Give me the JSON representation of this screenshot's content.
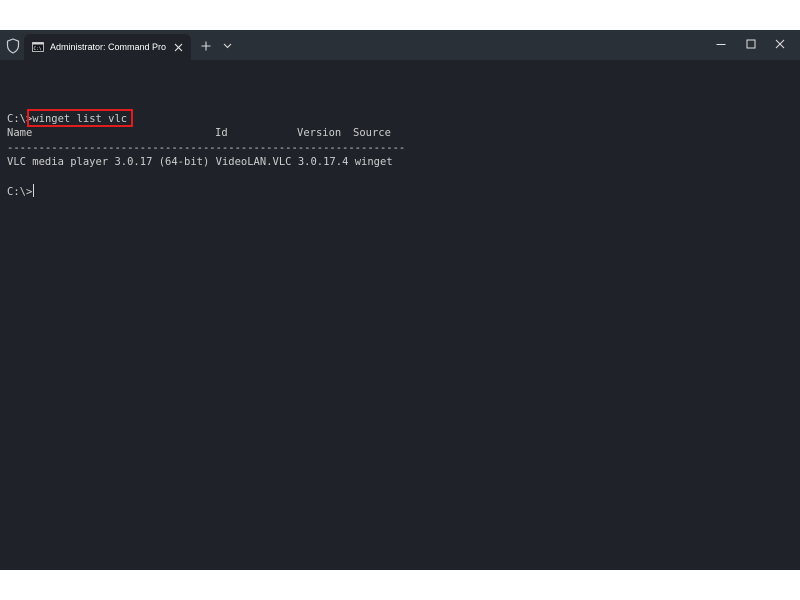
{
  "window": {
    "tab_title": "Administrator: Command Pro",
    "controls": {
      "minimize_icon": "minimize-icon",
      "maximize_icon": "maximize-icon",
      "close_icon": "close-icon"
    }
  },
  "terminal": {
    "prompt": "C:\\>",
    "command": "winget list vlc",
    "headers": {
      "name": "Name",
      "id": "Id",
      "version": "Version",
      "source": "Source"
    },
    "separator": "---------------------------------------------------------------",
    "rows": [
      {
        "name": "VLC media player 3.0.17 (64-bit)",
        "id": "VideoLAN.VLC",
        "version": "3.0.17.4",
        "source": "winget"
      }
    ],
    "final_prompt": "C:\\>"
  },
  "colors": {
    "terminal_background": "#1f2329",
    "titlebar_background": "#2a3037",
    "text": "#cccccc",
    "highlight_box": "#e21b1b"
  }
}
